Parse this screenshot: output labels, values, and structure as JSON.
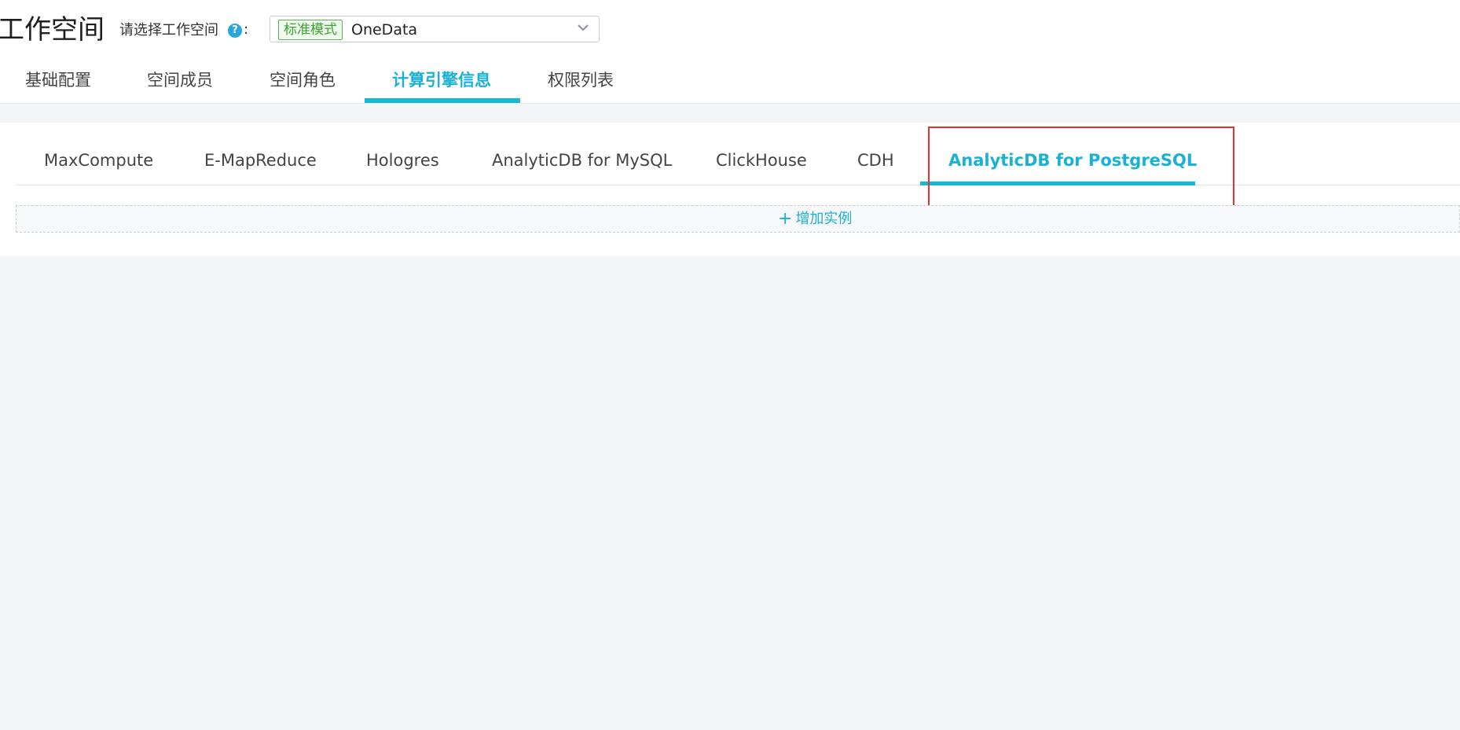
{
  "header": {
    "title": "工作空间",
    "workspace_label": "请选择工作空间",
    "help_glyph": "?",
    "colon": ":",
    "mode_tag": "标准模式",
    "workspace_value": "OneData"
  },
  "main_tabs": [
    {
      "label": "基础配置",
      "active": false
    },
    {
      "label": "空间成员",
      "active": false
    },
    {
      "label": "空间角色",
      "active": false
    },
    {
      "label": "计算引擎信息",
      "active": true
    },
    {
      "label": "权限列表",
      "active": false
    }
  ],
  "engine_tabs": [
    {
      "label": "MaxCompute",
      "active": false
    },
    {
      "label": "E-MapReduce",
      "active": false
    },
    {
      "label": "Hologres",
      "active": false
    },
    {
      "label": "AnalyticDB for MySQL",
      "active": false
    },
    {
      "label": "ClickHouse",
      "active": false
    },
    {
      "label": "CDH",
      "active": false
    },
    {
      "label": "AnalyticDB for PostgreSQL",
      "active": true
    }
  ],
  "add_instance": {
    "icon": "plus-icon",
    "plus_glyph": "+",
    "label": "增加实例"
  },
  "colors": {
    "accent": "#12bad4",
    "highlight_box": "#e5312f",
    "mode_tag": "#3aa22f",
    "background": "#f4f5f8"
  }
}
